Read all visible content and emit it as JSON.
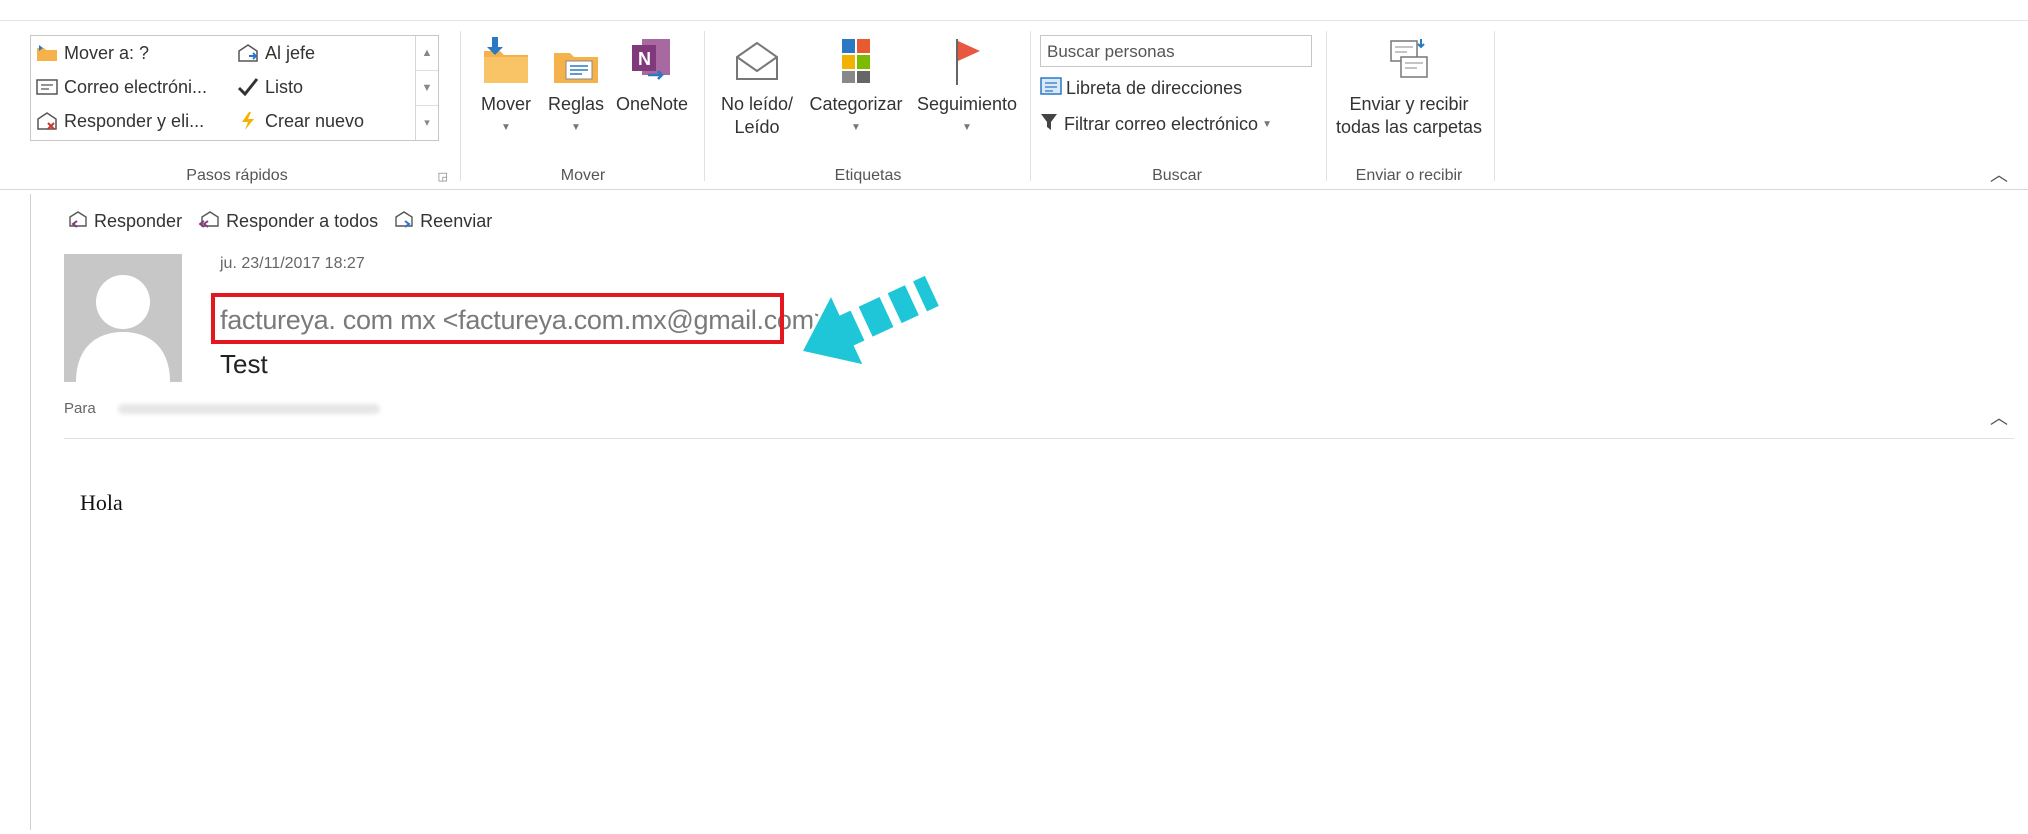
{
  "ribbon": {
    "quick_steps": {
      "items": [
        {
          "icon": "move-to-folder-icon",
          "label": "Mover a: ?"
        },
        {
          "icon": "forward-manager-icon",
          "label": "Al jefe"
        },
        {
          "icon": "email-icon",
          "label": "Correo electróni..."
        },
        {
          "icon": "checkmark-icon",
          "label": "Listo"
        },
        {
          "icon": "reply-delete-icon",
          "label": "Responder y eli..."
        },
        {
          "icon": "create-new-icon",
          "label": "Crear nuevo"
        }
      ],
      "group_label": "Pasos rápidos"
    },
    "move_group": {
      "buttons": [
        {
          "label": "Mover",
          "icon": "move-folder-icon"
        },
        {
          "label": "Reglas",
          "icon": "rules-icon"
        },
        {
          "label": "OneNote",
          "icon": "onenote-icon"
        }
      ],
      "group_label": "Mover"
    },
    "tags_group": {
      "buttons": [
        {
          "label_line1": "No leído/",
          "label_line2": "Leído",
          "icon": "unread-read-icon"
        },
        {
          "label": "Categorizar",
          "icon": "categorize-icon"
        },
        {
          "label": "Seguimiento",
          "icon": "follow-up-flag-icon"
        }
      ],
      "group_label": "Etiquetas"
    },
    "find_group": {
      "search_placeholder": "Buscar personas",
      "address_book": "Libreta de direcciones",
      "filter_email": "Filtrar correo electrónico",
      "group_label": "Buscar"
    },
    "send_receive_group": {
      "label_line1": "Enviar y recibir",
      "label_line2": "todas las carpetas",
      "group_label": "Enviar o recibir"
    }
  },
  "message": {
    "actions": [
      {
        "label": "Responder",
        "icon": "reply-icon"
      },
      {
        "label": "Responder a todos",
        "icon": "reply-all-icon"
      },
      {
        "label": "Reenviar",
        "icon": "forward-icon"
      }
    ],
    "date": "ju. 23/11/2017 18:27",
    "sender": "factureya. com mx <factureya.com.mx@gmail.com>",
    "subject": "Test",
    "to_label": "Para",
    "body": "Hola"
  },
  "colors": {
    "highlight_box": "#e41620",
    "arrow": "#1fc6d8",
    "folder": "#f6b24a",
    "onenote": "#80397b",
    "flag": "#e8573f"
  }
}
